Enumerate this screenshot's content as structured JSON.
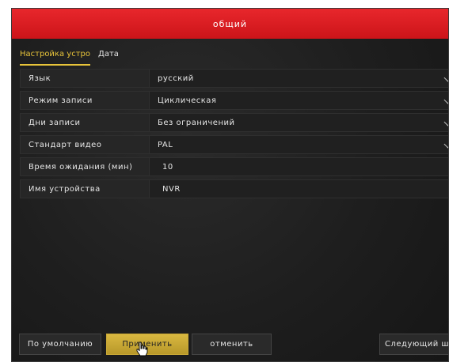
{
  "window": {
    "title": "общий"
  },
  "tabs": [
    {
      "label": "Настройка устро",
      "active": true
    },
    {
      "label": "Дата",
      "active": false
    }
  ],
  "settings": [
    {
      "label": "Язык",
      "value": "русский",
      "type": "dropdown"
    },
    {
      "label": "Режим записи",
      "value": "Циклическая",
      "type": "dropdown"
    },
    {
      "label": "Дни записи",
      "value": "Без ограничений",
      "type": "dropdown"
    },
    {
      "label": "Стандарт видео",
      "value": "PAL",
      "type": "dropdown"
    },
    {
      "label": "Время ожидания (мин)",
      "value": "10",
      "type": "input"
    },
    {
      "label": "Имя устройства",
      "value": "NVR",
      "type": "input"
    }
  ],
  "buttons": {
    "default_label": "По умолчанию",
    "apply_label": "Применить",
    "cancel_label": "отменить",
    "next_label": "Следующий ша"
  },
  "colors": {
    "title_bar": "#d9191e",
    "accent": "#e8c43a",
    "apply_button": "#c9a835"
  }
}
